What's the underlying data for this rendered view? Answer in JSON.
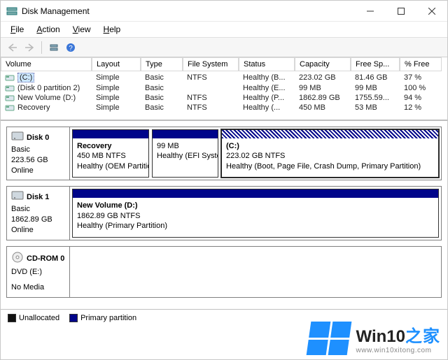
{
  "titlebar": {
    "title": "Disk Management"
  },
  "menu": {
    "file": "File",
    "action": "Action",
    "view": "View",
    "help": "Help"
  },
  "columns": {
    "volume": "Volume",
    "layout": "Layout",
    "type": "Type",
    "fs": "File System",
    "status": "Status",
    "capacity": "Capacity",
    "free": "Free Sp...",
    "pct": "% Free"
  },
  "volumes": [
    {
      "name": "(C:)",
      "layout": "Simple",
      "type": "Basic",
      "fs": "NTFS",
      "status": "Healthy (B...",
      "capacity": "223.02 GB",
      "free": "81.46 GB",
      "pct": "37 %",
      "selected": true
    },
    {
      "name": "(Disk 0 partition 2)",
      "layout": "Simple",
      "type": "Basic",
      "fs": "",
      "status": "Healthy (E...",
      "capacity": "99 MB",
      "free": "99 MB",
      "pct": "100 %",
      "selected": false
    },
    {
      "name": "New Volume (D:)",
      "layout": "Simple",
      "type": "Basic",
      "fs": "NTFS",
      "status": "Healthy (P...",
      "capacity": "1862.89 GB",
      "free": "1755.59...",
      "pct": "94 %",
      "selected": false
    },
    {
      "name": "Recovery",
      "layout": "Simple",
      "type": "Basic",
      "fs": "NTFS",
      "status": "Healthy (...",
      "capacity": "450 MB",
      "free": "53 MB",
      "pct": "12 %",
      "selected": false
    }
  ],
  "disks": [
    {
      "name": "Disk 0",
      "kind": "Basic",
      "size": "223.56 GB",
      "state": "Online",
      "icon": "hdd",
      "parts": [
        {
          "title": "Recovery",
          "sub": "450 MB NTFS",
          "status": "Healthy (OEM Partition)",
          "flex": "0 0 110px",
          "selected": false
        },
        {
          "title": "",
          "sub": "99 MB",
          "status": "Healthy (EFI System",
          "flex": "0 0 95px",
          "selected": false
        },
        {
          "title": "(C:)",
          "sub": "223.02 GB NTFS",
          "status": "Healthy (Boot, Page File, Crash Dump, Primary Partition)",
          "flex": "1 1 auto",
          "selected": true
        }
      ]
    },
    {
      "name": "Disk 1",
      "kind": "Basic",
      "size": "1862.89 GB",
      "state": "Online",
      "icon": "hdd",
      "parts": [
        {
          "title": "New Volume  (D:)",
          "sub": "1862.89 GB NTFS",
          "status": "Healthy (Primary Partition)",
          "flex": "1 1 auto",
          "selected": false
        }
      ]
    },
    {
      "name": "CD-ROM 0",
      "kind": "DVD (E:)",
      "size": "",
      "state": "No Media",
      "icon": "cd",
      "parts": []
    }
  ],
  "legend": {
    "unallocated": "Unallocated",
    "primary": "Primary partition"
  },
  "watermark": {
    "brand": "Win10",
    "zh": "之家",
    "url": "www.win10xitong.com"
  }
}
